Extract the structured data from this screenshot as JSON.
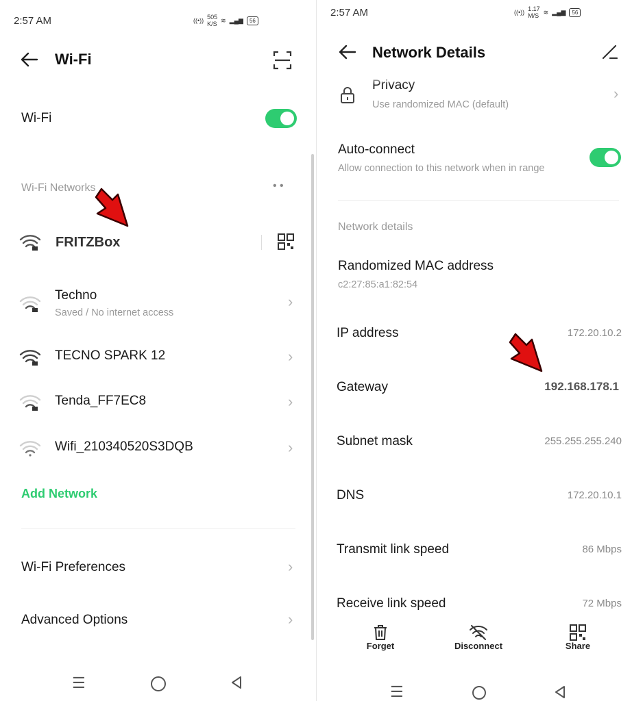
{
  "left": {
    "status_time": "2:57 AM",
    "status_speed": "505",
    "status_speed_unit": "K/S",
    "battery": "56",
    "title": "Wi-Fi",
    "wifi_label": "Wi-Fi",
    "networks_header": "Wi-Fi Networks",
    "connected_network": "FRITZBox",
    "networks": [
      {
        "name": "Techno",
        "sub": "Saved / No internet access"
      },
      {
        "name": "TECNO SPARK 12",
        "sub": ""
      },
      {
        "name": "Tenda_FF7EC8",
        "sub": ""
      },
      {
        "name": "Wifi_210340520S3DQB",
        "sub": ""
      }
    ],
    "add_network": "Add Network",
    "preferences": "Wi-Fi Preferences",
    "advanced": "Advanced Options"
  },
  "right": {
    "status_time": "2:57 AM",
    "status_speed": "1.17",
    "status_speed_unit": "M/S",
    "battery": "56",
    "title": "Network Details",
    "privacy_title": "Privacy",
    "privacy_sub": "Use randomized MAC (default)",
    "autoconnect_title": "Auto-connect",
    "autoconnect_sub": "Allow connection to this network when in range",
    "details_header": "Network details",
    "mac_title": "Randomized MAC address",
    "mac_value": "c2:27:85:a1:82:54",
    "details": [
      {
        "label": "IP address",
        "value": "172.20.10.2"
      },
      {
        "label": "Gateway",
        "value": "192.168.178.1"
      },
      {
        "label": "Subnet mask",
        "value": "255.255.255.240"
      },
      {
        "label": "DNS",
        "value": "172.20.10.1"
      },
      {
        "label": "Transmit link speed",
        "value": "86 Mbps"
      },
      {
        "label": "Receive link speed",
        "value": "72 Mbps"
      }
    ],
    "actions": {
      "forget": "Forget",
      "disconnect": "Disconnect",
      "share": "Share"
    }
  },
  "colors": {
    "accent": "#2ecc71",
    "arrow": "#e01010"
  }
}
